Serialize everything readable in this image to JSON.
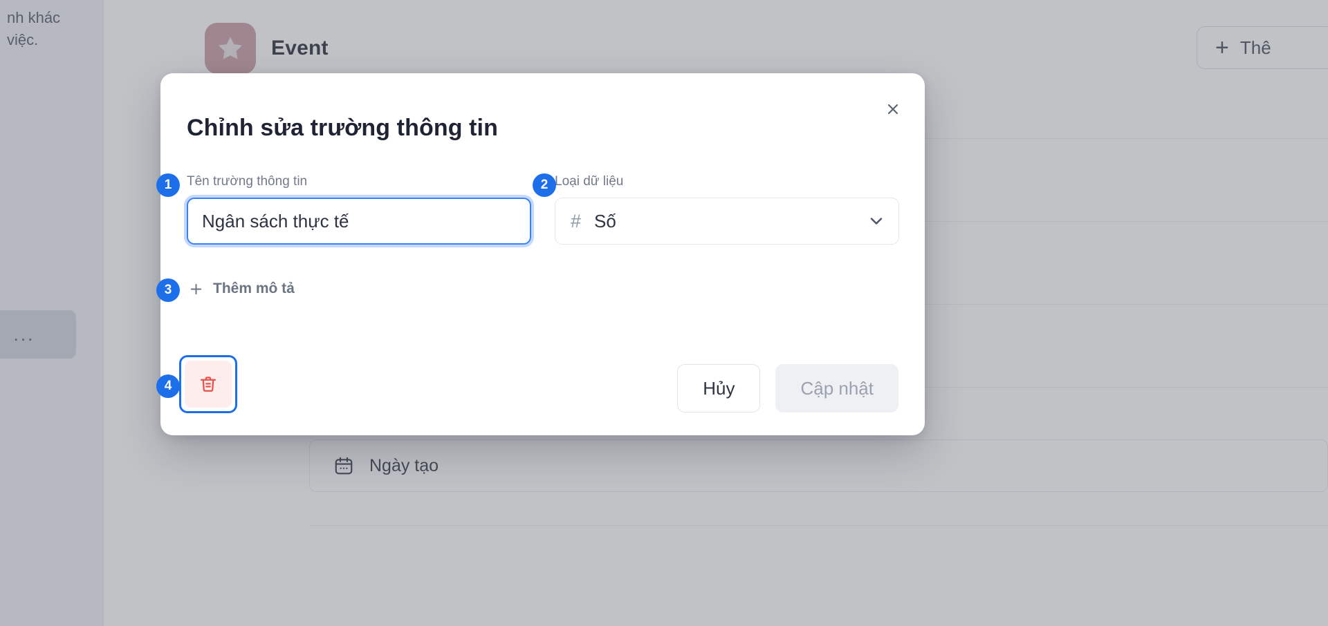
{
  "background": {
    "left_panel": {
      "line1": "nh khác",
      "line2": "việc.",
      "more_chip": "..."
    },
    "header": {
      "app_icon": "star-icon",
      "title": "Event",
      "add_button": {
        "icon": "plus-icon",
        "label": "Thê"
      }
    },
    "rows": [
      {
        "icon": "calendar-icon",
        "label": "Ngày tạo"
      }
    ]
  },
  "modal": {
    "title": "Chỉnh sửa trường thông tin",
    "close_icon": "close-icon",
    "fields": {
      "name": {
        "label": "Tên trường thông tin",
        "value": "Ngân sách thực tế",
        "placeholder": "Tên trường thông tin"
      },
      "data_type": {
        "label": "Loại dữ liệu",
        "type_icon": "#",
        "value": "Số",
        "chevron": "chevron-down-icon"
      }
    },
    "add_description": {
      "icon": "plus-icon",
      "label": "Thêm mô tả"
    },
    "delete_button": {
      "icon": "trash-icon"
    },
    "actions": {
      "cancel_label": "Hủy",
      "submit_label": "Cập nhật"
    }
  },
  "annotations": {
    "badges": [
      "1",
      "2",
      "3",
      "4"
    ]
  },
  "colors": {
    "accent_blue": "#1c6fe8",
    "focus_blue": "#3b82f6",
    "danger_red": "#e8524a",
    "danger_bg": "#fdeeed",
    "app_icon_bg": "#c89aa0",
    "disabled_bg": "#eef0f4",
    "label_gray": "#707a8a"
  }
}
